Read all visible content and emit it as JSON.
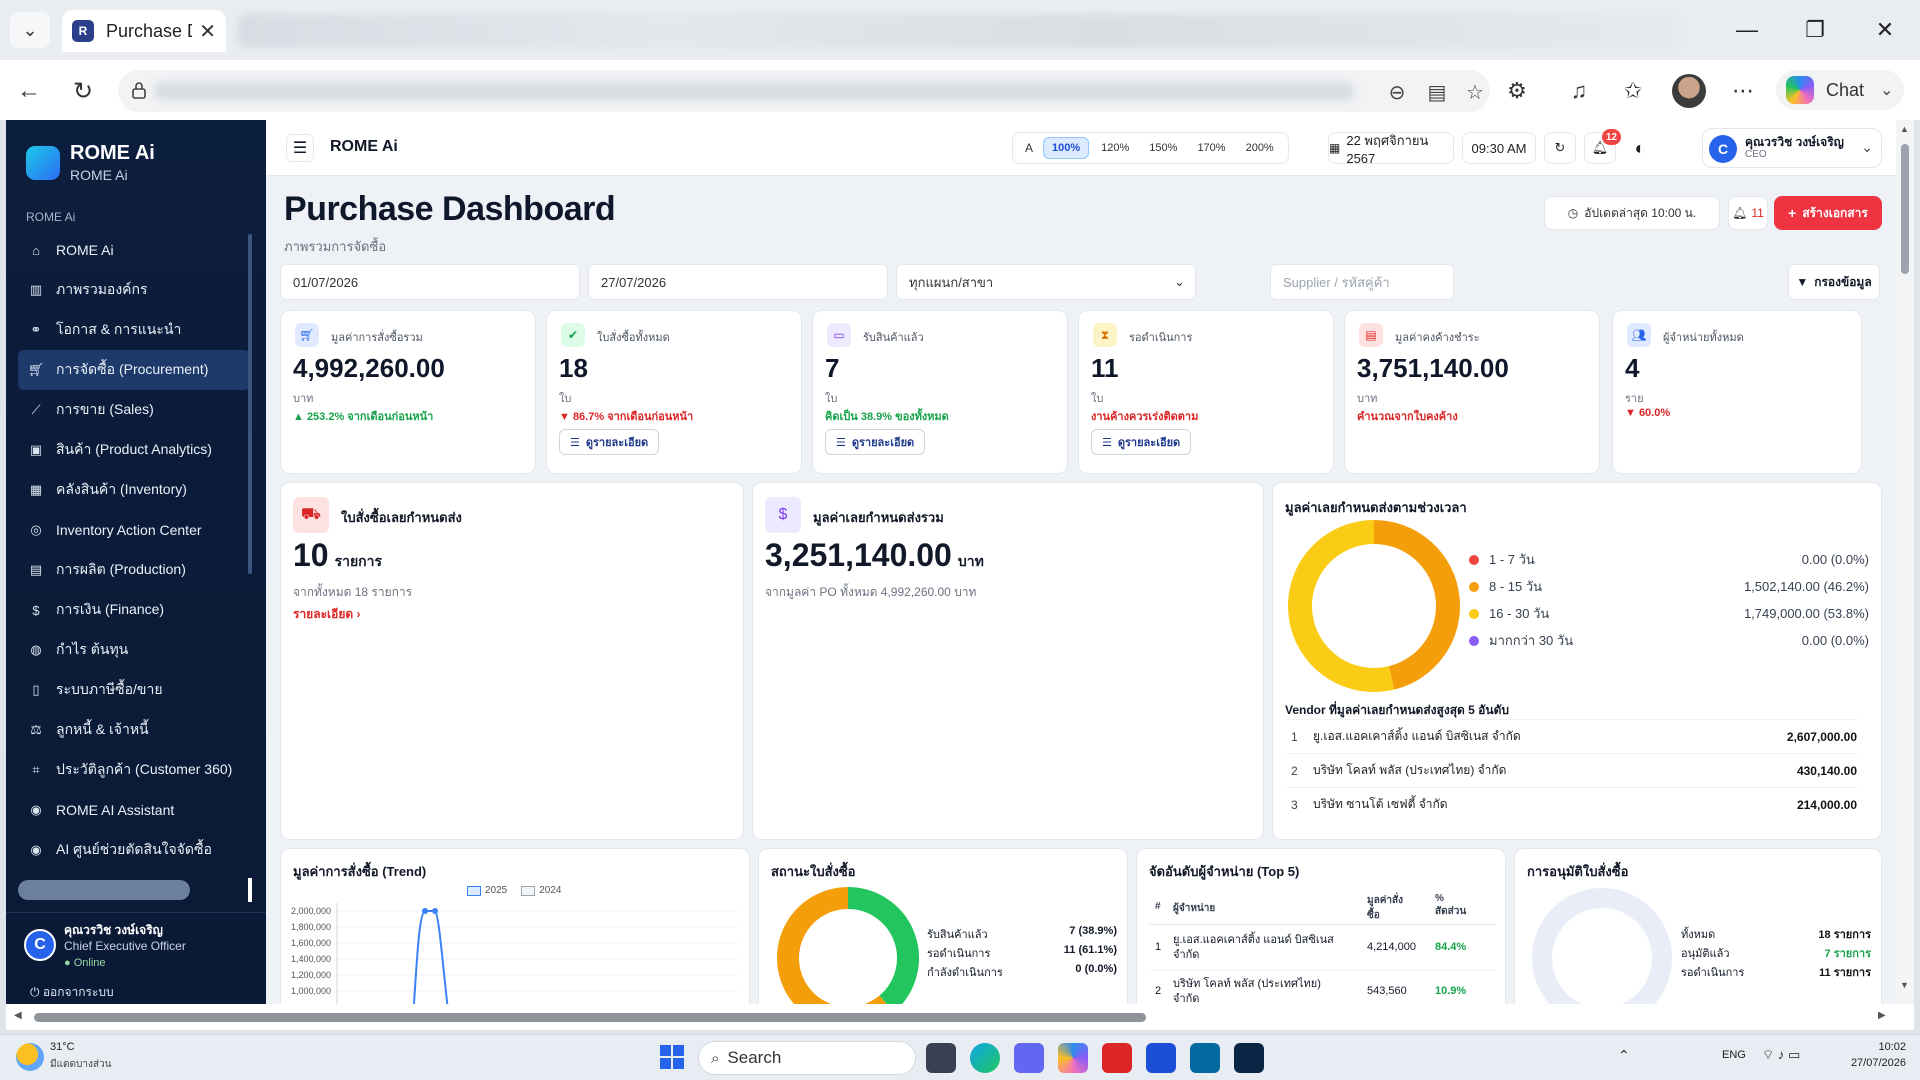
{
  "browser": {
    "tab_title": "Purchase D",
    "favicon_letter": "R",
    "chat_label": "Chat"
  },
  "sidebar": {
    "brand": "ROME Ai",
    "brand_sub": "ROME Ai",
    "section_label": "ROME Ai",
    "items": [
      {
        "label": "ROME Ai",
        "icon": "home-icon"
      },
      {
        "label": "ภาพรวมองค์กร",
        "icon": "building-icon"
      },
      {
        "label": "โอกาส & การแนะนำ",
        "icon": "link-icon"
      },
      {
        "label": "การจัดซื้อ (Procurement)",
        "icon": "cart-icon"
      },
      {
        "label": "การขาย (Sales)",
        "icon": "chart-line-icon"
      },
      {
        "label": "สินค้า (Product Analytics)",
        "icon": "boxes-icon"
      },
      {
        "label": "คลังสินค้า (Inventory)",
        "icon": "warehouse-icon"
      },
      {
        "label": "Inventory Action Center",
        "icon": "target-icon"
      },
      {
        "label": "การผลิต (Production)",
        "icon": "factory-icon"
      },
      {
        "label": "การเงิน (Finance)",
        "icon": "money-bag-icon"
      },
      {
        "label": "กำไร ต้นทุน",
        "icon": "coins-icon"
      },
      {
        "label": "ระบบภาษีซื้อ/ขาย",
        "icon": "receipt-icon"
      },
      {
        "label": "ลูกหนี้ & เจ้าหนี้",
        "icon": "scale-icon"
      },
      {
        "label": "ประวัติลูกค้า (Customer 360)",
        "icon": "scan-icon"
      },
      {
        "label": "ROME AI Assistant",
        "icon": "robot-icon"
      },
      {
        "label": "AI ศูนย์ช่วยตัดสินใจจัดซื้อ",
        "icon": "robot-icon"
      }
    ],
    "active_index": 3,
    "user": {
      "initial": "C",
      "name": "คุณวรวิช วงษ์เจริญ",
      "role": "Chief Executive Officer",
      "status": "Online"
    },
    "logout": "ออกจากระบบ"
  },
  "header": {
    "title": "ROME Ai",
    "zoom_a": "A",
    "zoom_levels": [
      "100%",
      "120%",
      "150%",
      "170%",
      "200%"
    ],
    "zoom_active": "100%",
    "date": "22 พฤศจิกายน 2567",
    "time": "09:30 AM",
    "notif_count": "12",
    "user_initial": "C",
    "user_name": "คุณวรวิช วงษ์เจริญ",
    "user_role": "CEO"
  },
  "page": {
    "title": "Purchase Dashboard",
    "subtitle": "ภาพรวมการจัดซื้อ",
    "updated": "อัปเดตล่าสุด 10:00 น.",
    "alert_count": "11",
    "create_label": "สร้างเอกสาร"
  },
  "filters": {
    "date_from": "01/07/2026",
    "date_to": "27/07/2026",
    "branch": "ทุกแผนก/สาขา",
    "supplier_placeholder": "Supplier / รหัสคู่ค้า",
    "filter_label": "กรองข้อมูล"
  },
  "kpis": [
    {
      "label": "มูลค่าการสั่งซื้อรวม",
      "value": "4,992,260.00",
      "unit": "บาท",
      "change": "▲ 253.2% จากเดือนก่อนหน้า",
      "tone": "green",
      "icon": "cart-icon",
      "color": "#2563eb",
      "bg": "#e0eaff",
      "detail": ""
    },
    {
      "label": "ใบสั่งซื้อทั้งหมด",
      "value": "18",
      "unit": "ใบ",
      "change": "▼ 86.7% จากเดือนก่อนหน้า",
      "tone": "red",
      "icon": "check-circle-icon",
      "color": "#16a34a",
      "bg": "#dcfce7",
      "detail": "ดูรายละเอียด"
    },
    {
      "label": "รับสินค้าแล้ว",
      "value": "7",
      "unit": "ใบ",
      "change": "คิดเป็น 38.9% ของทั้งหมด",
      "tone": "green",
      "icon": "inbox-icon",
      "color": "#7c3aed",
      "bg": "#ede9fe",
      "detail": "ดูรายละเอียด"
    },
    {
      "label": "รอดำเนินการ",
      "value": "11",
      "unit": "ใบ",
      "change": "งานค้างควรเร่งติดตาม",
      "tone": "red",
      "icon": "hourglass-icon",
      "color": "#d97706",
      "bg": "#fef3c7",
      "detail": "ดูรายละเอียด"
    },
    {
      "label": "มูลค่าคงค้างชำระ",
      "value": "3,751,140.00",
      "unit": "บาท",
      "change": "คำนวณจากใบคงค้าง",
      "tone": "red",
      "icon": "invoice-icon",
      "color": "#dc2626",
      "bg": "#fee2e2",
      "detail": ""
    },
    {
      "label": "ผู้จำหน่ายทั้งหมด",
      "value": "4",
      "unit": "ราย",
      "change": "▼ 60.0%",
      "tone": "red",
      "icon": "users-icon",
      "color": "#2563eb",
      "bg": "#e0eaff",
      "detail": ""
    }
  ],
  "overdue_po": {
    "title": "ใบสั่งซื้อเลยกำหนดส่ง",
    "value": "10",
    "unit": "รายการ",
    "sub": "จากทั้งหมด 18 รายการ",
    "link": "รายละเอียด"
  },
  "overdue_value": {
    "title": "มูลค่าเลยกำหนดส่งรวม",
    "value": "3,251,140.00",
    "unit": "บาท",
    "sub": "จากมูลค่า PO ทั้งหมด 4,992,260.00 บาท"
  },
  "aging": {
    "title": "มูลค่าเลยกำหนดส่งตามช่วงเวลา",
    "buckets": [
      {
        "label": "1 - 7 วัน",
        "value": "0.00 (0.0%)",
        "pct": 0.0,
        "color": "#ef4444"
      },
      {
        "label": "8 - 15 วัน",
        "value": "1,502,140.00 (46.2%)",
        "pct": 46.2,
        "color": "#f59e0b"
      },
      {
        "label": "16 - 30 วัน",
        "value": "1,749,000.00 (53.8%)",
        "pct": 53.8,
        "color": "#facc15"
      },
      {
        "label": "มากกว่า 30 วัน",
        "value": "0.00 (0.0%)",
        "pct": 0.0,
        "color": "#8b5cf6"
      }
    ],
    "vendor_title": "Vendor ที่มูลค่าเลยกำหนดส่งสูงสุด 5 อันดับ",
    "vendors": [
      {
        "rank": "1",
        "name": "ยู.เอส.แอคเคาส์ติ้ง แอนด์ บิสซิเนส จำกัด",
        "value": "2,607,000.00"
      },
      {
        "rank": "2",
        "name": "บริษัท โคลท์ พลัส (ประเทศไทย) จำกัด",
        "value": "430,140.00"
      },
      {
        "rank": "3",
        "name": "บริษัท ซานโต้ เซฟตี้ จำกัด",
        "value": "214,000.00"
      }
    ]
  },
  "trend": {
    "title": "มูลค่าการสั่งซื้อ (Trend)",
    "legend": [
      "2025",
      "2024"
    ],
    "yticks": [
      "2,000,000",
      "1,800,000",
      "1,600,000",
      "1,400,000",
      "1,200,000",
      "1,000,000"
    ]
  },
  "po_status": {
    "title": "สถานะใบสั่งซื้อ",
    "rows": [
      {
        "label": "รับสินค้าแล้ว",
        "value": "7 (38.9%)"
      },
      {
        "label": "รอดำเนินการ",
        "value": "11 (61.1%)"
      },
      {
        "label": "กำลังดำเนินการ",
        "value": "0 (0.0%)"
      }
    ]
  },
  "top_vendors": {
    "title": "จัดอันดับผู้จำหน่าย (Top 5)",
    "col_rank": "#",
    "col_vendor": "ผู้จำหน่าย",
    "col_value": "มูลค่าสั่งซื้อ",
    "col_pct": "% สัดส่วน",
    "rows": [
      {
        "rank": "1",
        "name": "ยู.เอส.แอคเคาส์ติ้ง แอนด์ บิสซิเนส จำกัด",
        "value": "4,214,000",
        "pct": "84.4%"
      },
      {
        "rank": "2",
        "name": "บริษัท โคลท์ พลัส (ประเทศไทย) จำกัด",
        "value": "543,560",
        "pct": "10.9%"
      }
    ]
  },
  "approval": {
    "title": "การอนุมัติใบสั่งซื้อ",
    "rows": [
      {
        "label": "ทั้งหมด",
        "value": "18 รายการ",
        "tone": "dark"
      },
      {
        "label": "อนุมัติแล้ว",
        "value": "7 รายการ",
        "tone": "green"
      },
      {
        "label": "รอดำเนินการ",
        "value": "11 รายการ",
        "tone": "dark"
      }
    ]
  },
  "taskbar": {
    "weather_temp": "31°C",
    "weather_desc": "มีแดดบางส่วน",
    "search": "Search",
    "lang": "ENG",
    "time": "10:02",
    "date": "27/07/2026"
  }
}
